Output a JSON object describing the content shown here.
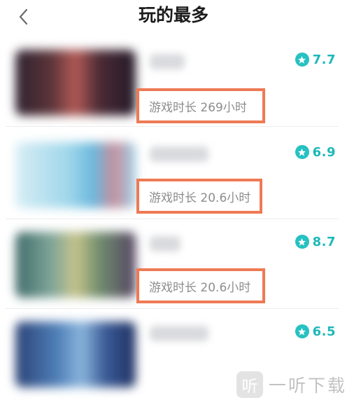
{
  "header": {
    "title": "玩的最多",
    "back_icon": "chevron-left-icon"
  },
  "games": [
    {
      "rating": "7.7",
      "playtime": "游戏时长 269小时",
      "thumb_colors": [
        "#3b2a32",
        "#a8514f",
        "#5a2c36"
      ]
    },
    {
      "rating": "6.9",
      "playtime": "游戏时长 20.6小时",
      "thumb_colors": [
        "#cbe7f2",
        "#8fd0e8",
        "#d5a0a8"
      ]
    },
    {
      "rating": "8.7",
      "playtime": "游戏时长 20.6小时",
      "thumb_colors": [
        "#4e7c73",
        "#b9c28b",
        "#5d4e6c"
      ]
    },
    {
      "rating": "6.5",
      "playtime": "",
      "thumb_colors": [
        "#2f4e87",
        "#5a88c0",
        "#253a70"
      ]
    }
  ],
  "watermark": {
    "logo": "听",
    "text": "一听下载"
  },
  "colors": {
    "accent": "#27c1c2",
    "highlight_border": "#ee7a54"
  }
}
